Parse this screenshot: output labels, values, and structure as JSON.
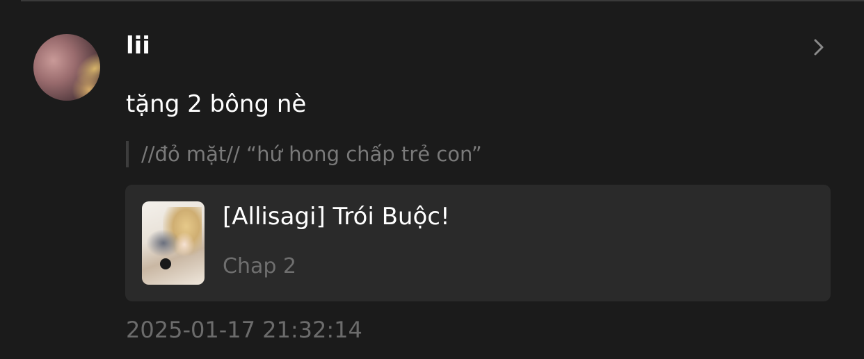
{
  "comment": {
    "username": "lii",
    "text": "tặng 2 bông nè",
    "quote": "//đỏ mặt// “hứ hong chấp trẻ con”",
    "timestamp": "2025-01-17 21:32:14"
  },
  "manga_card": {
    "title": "[Allisagi] Trói Buộc!",
    "chapter": "Chap 2"
  },
  "icons": {
    "chevron": "chevron-right-icon",
    "avatar": "avatar",
    "cover": "manga-cover"
  },
  "colors": {
    "background": "#1b1b1b",
    "card": "#2a2a2a",
    "text_primary": "#ffffff",
    "text_muted": "#6f6f6f"
  }
}
